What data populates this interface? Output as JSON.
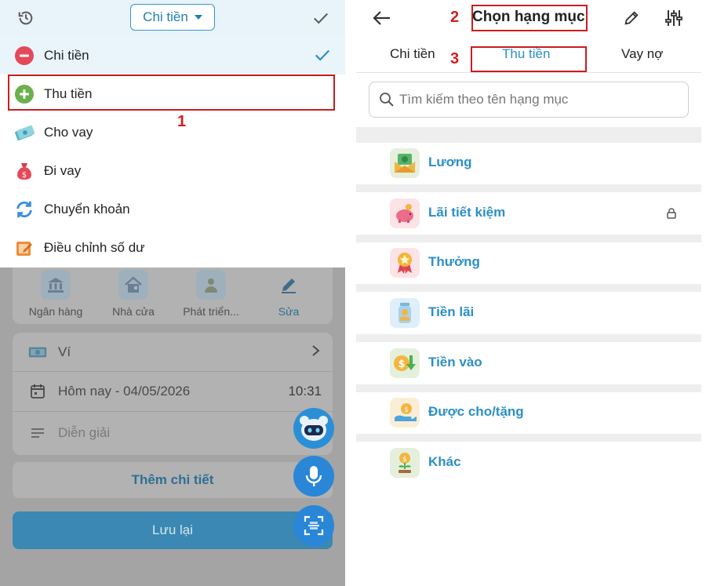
{
  "left": {
    "dropdown_label": "Chi tiền",
    "menu": [
      {
        "label": "Chi tiền",
        "icon": "minus-circle-icon"
      },
      {
        "label": "Thu tiền",
        "icon": "plus-circle-icon"
      },
      {
        "label": "Cho vay",
        "icon": "money-notes-icon"
      },
      {
        "label": "Đi vay",
        "icon": "money-bag-icon"
      },
      {
        "label": "Chuyển khoản",
        "icon": "transfer-arrows-icon"
      },
      {
        "label": "Điều chỉnh số dư",
        "icon": "edit-balance-icon"
      }
    ],
    "categories": [
      {
        "label": "Ngân hàng"
      },
      {
        "label": "Nhà cửa"
      },
      {
        "label": "Phát triển..."
      },
      {
        "label": "Sửa"
      }
    ],
    "wallet": "Ví",
    "date": "Hôm nay - 04/05/2026",
    "time": "10:31",
    "note_placeholder": "Diễn giải",
    "more_details": "Thêm chi tiết",
    "save": "Lưu lại"
  },
  "right": {
    "title": "Chọn hạng mục",
    "tabs": [
      "Chi tiền",
      "Thu tiền",
      "Vay nợ"
    ],
    "search_placeholder": "Tìm kiếm theo tên hạng mục",
    "items": [
      {
        "label": "Lương",
        "icon": "salary-envelope-icon"
      },
      {
        "label": "Lãi tiết kiệm",
        "icon": "piggy-bank-icon",
        "locked": true
      },
      {
        "label": "Thưởng",
        "icon": "award-medal-icon"
      },
      {
        "label": "Tiền lãi",
        "icon": "coin-jar-icon"
      },
      {
        "label": "Tiền vào",
        "icon": "coin-in-icon"
      },
      {
        "label": "Được cho/tặng",
        "icon": "gift-hand-icon"
      },
      {
        "label": "Khác",
        "icon": "money-plant-icon"
      }
    ]
  },
  "annotations": {
    "step1": "1",
    "step2": "2",
    "step3": "3"
  },
  "colors": {
    "accent": "#2b8fc6",
    "annotation_red": "#c81e1e",
    "expense_red": "#e4495a",
    "income_green": "#6ab04c"
  }
}
